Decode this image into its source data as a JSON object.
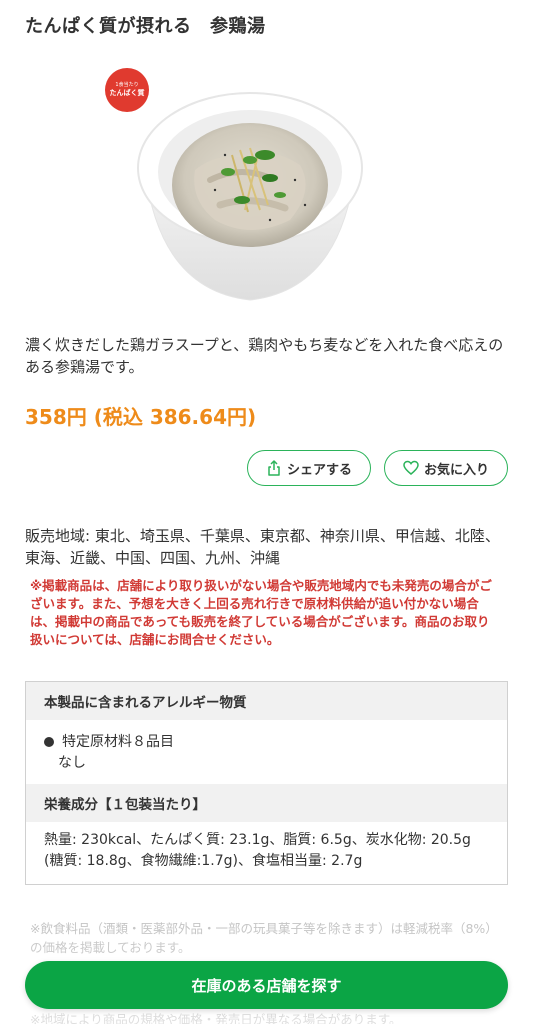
{
  "product": {
    "title": "たんぱく質が摂れる　参鶏湯",
    "badge_small": "1食当たり",
    "badge_big": "たんぱく質",
    "description": "濃く炊きだした鶏ガラスープと、鶏肉やもち麦などを入れた食べ応えのある参鶏湯です。",
    "price": "358円 (税込 386.64円)"
  },
  "actions": {
    "share_label": "シェアする",
    "favorite_label": "お気に入り",
    "find_store_label": "在庫のある店舗を探す"
  },
  "availability": {
    "region": "販売地域: 東北、埼玉県、千葉県、東京都、神奈川県、甲信越、北陸、東海、近畿、中国、四国、九州、沖縄",
    "notice": "※掲載商品は、店舗により取り扱いがない場合や販売地域内でも未発売の場合がございます。また、予想を大きく上回る売れ行きで原材料供給が追い付かない場合は、掲載中の商品であっても販売を終了している場合がございます。商品のお取り扱いについては、店舗にお問合せください。"
  },
  "allergy": {
    "heading": "本製品に含まれるアレルギー物質",
    "item_label": "特定原材料８品目",
    "item_value": "なし"
  },
  "nutrition": {
    "heading": "栄養成分【１包装当たり】",
    "text": "熱量: 230kcal、たんぱく質: 23.1g、脂質: 6.5g、炭水化物: 20.5g (糖質: 18.8g、食物繊維:1.7g)、食塩相当量: 2.7g"
  },
  "footnotes": {
    "tax_note": "※飲食料品（酒類・医薬部外品・一部の玩具菓子等を除きます）は軽減税率（8%）の価格を掲載しております。",
    "region_note": "※地域により商品の規格や価格・発売日が異なる場合があります。"
  },
  "colors": {
    "price": "#ee8b1a",
    "accent_green": "#0ba545",
    "notice_red": "#d13a35",
    "badge_red": "#e03a2f"
  },
  "icons": {
    "share": "share-icon",
    "favorite": "heart-icon"
  }
}
